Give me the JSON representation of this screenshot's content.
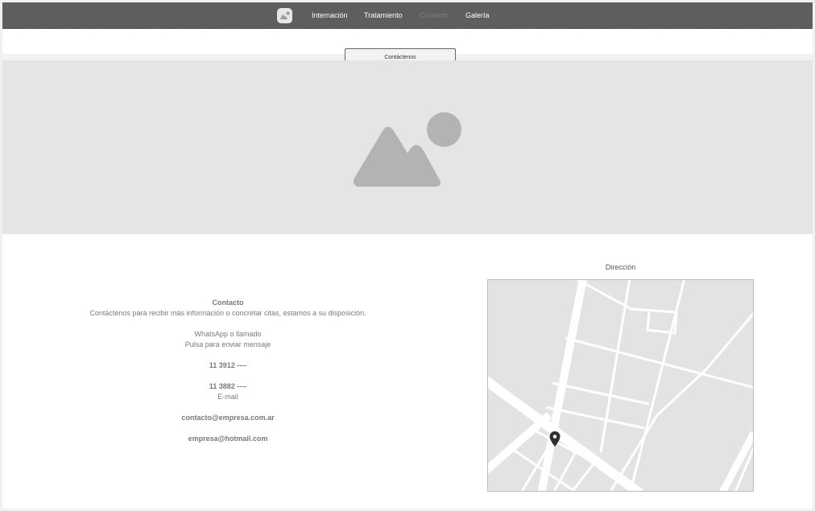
{
  "nav": {
    "logo_icon": "image-placeholder-icon",
    "items": [
      {
        "label": "Internación",
        "active": false
      },
      {
        "label": "Tratamiento",
        "active": false
      },
      {
        "label": "Contacto",
        "active": true
      },
      {
        "label": "Galería",
        "active": false
      }
    ]
  },
  "hero": {
    "button_label": "Contáctenos",
    "image_icon": "image-placeholder-icon"
  },
  "contact": {
    "title": "Contacto",
    "description": "Contáctenos para recibir más información o concretar citas, estamos a su disposición.",
    "whatsapp_label": "WhatsApp o llamado",
    "whatsapp_hint": "Pulsa para enviar mensaje",
    "phone_1": "11 3912 ----",
    "phone_2": "11 3882 ----",
    "email_label": "E-mail",
    "email_1": "contacto@empresa.com.ar",
    "email_2": "empresa@hotmail.com"
  },
  "map": {
    "title": "Dirección",
    "pin_icon": "map-pin-icon"
  },
  "colors": {
    "navbar": "#5c5c5c",
    "placeholder": "#e5e5e5",
    "placeholder_icon": "#b3b3b3",
    "text": "#7a7a7a"
  }
}
